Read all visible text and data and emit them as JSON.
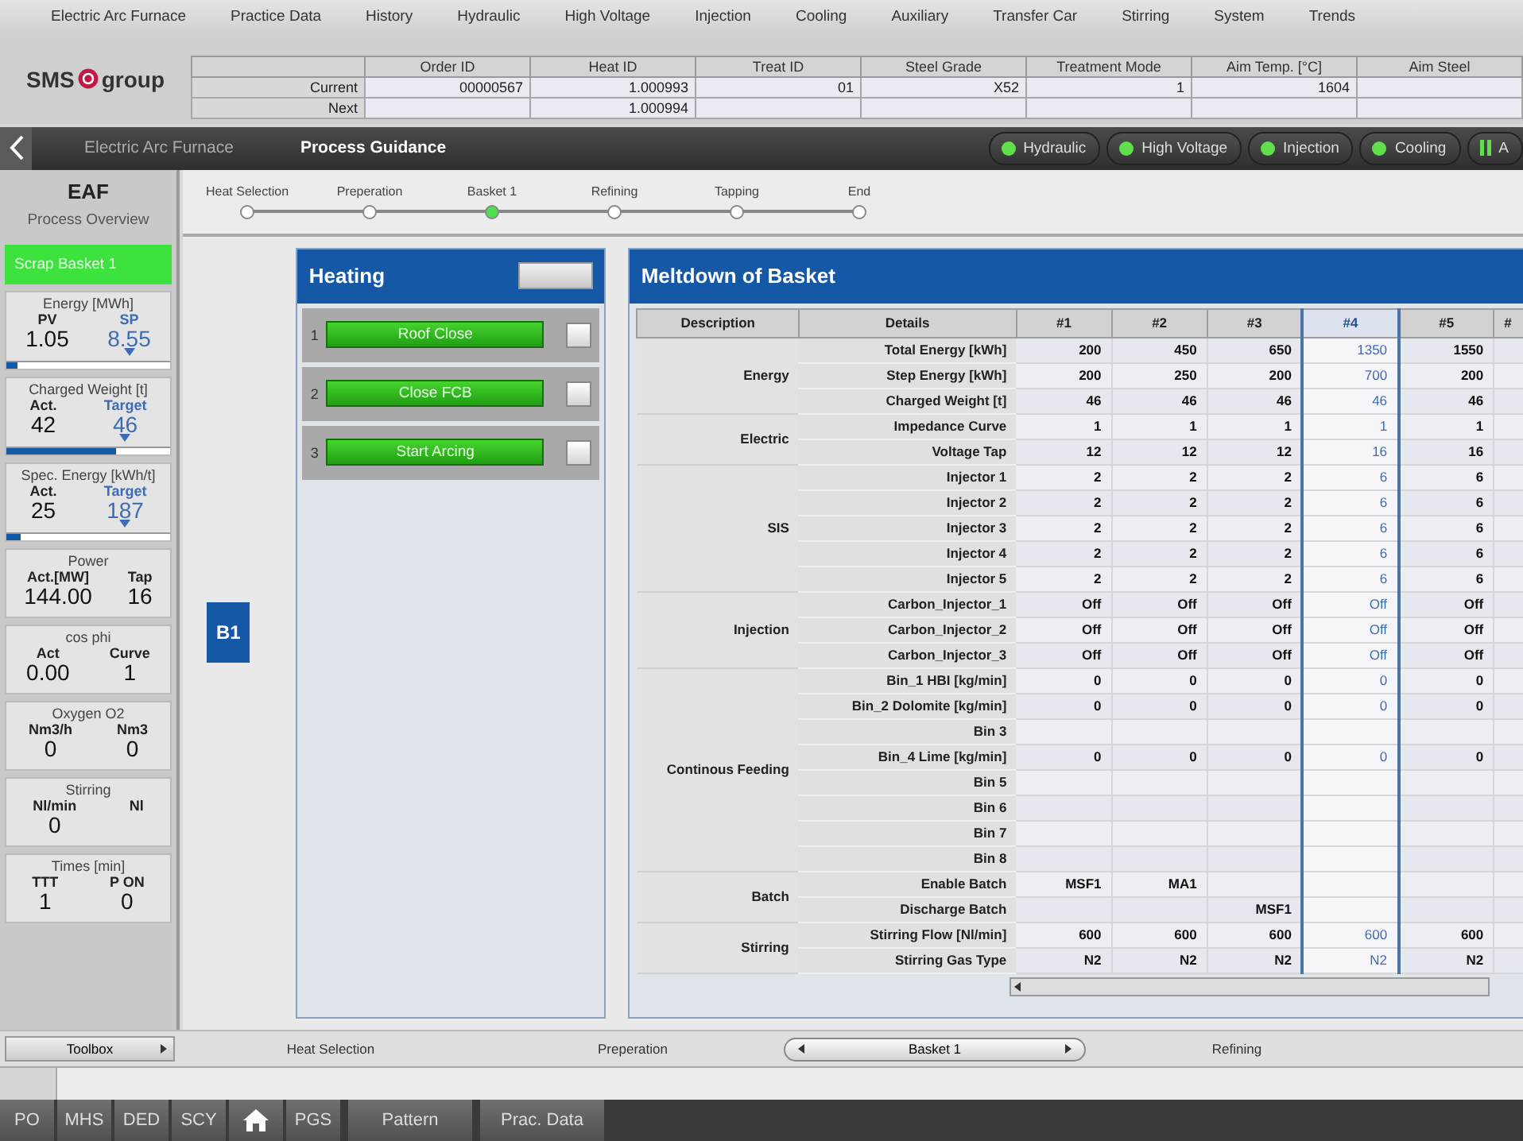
{
  "menu": [
    "Electric Arc Furnace",
    "Practice Data",
    "History",
    "Hydraulic",
    "High Voltage",
    "Injection",
    "Cooling",
    "Auxiliary",
    "Transfer Car",
    "Stirring",
    "System",
    "Trends"
  ],
  "logo": {
    "left": "SMS",
    "right": "group"
  },
  "heat_table": {
    "columns": [
      null,
      "Order ID",
      "Heat ID",
      "Treat ID",
      "Steel Grade",
      "Treatment Mode",
      "Aim Temp. [°C]",
      "Aim Steel"
    ],
    "rows": [
      [
        "Current",
        "00000567",
        "1.000993",
        "01",
        "X52",
        "1",
        "1604"
      ],
      [
        "Next",
        null,
        "1.000994"
      ]
    ]
  },
  "nav": {
    "breadcrumbs": [
      {
        "label": "Electric Arc Furnace",
        "selected": false
      },
      {
        "label": "Process Guidance",
        "selected": true
      }
    ],
    "status": [
      {
        "label": "Hydraulic",
        "kind": "ok"
      },
      {
        "label": "High Voltage",
        "kind": "ok"
      },
      {
        "label": "Injection",
        "kind": "ok"
      },
      {
        "label": "Cooling",
        "kind": "ok"
      },
      {
        "label": "A",
        "kind": "paused"
      }
    ]
  },
  "sidebar": {
    "title": "EAF",
    "subtitle": "Process Overview",
    "banner": "Scrap Basket 1",
    "cards": [
      {
        "title": "Energy [MWh]",
        "left": {
          "label": "PV",
          "value": "1.05"
        },
        "right": {
          "label": "SP",
          "value": "8.55",
          "target": true
        },
        "level": 0.07
      },
      {
        "title": "Charged Weight [t]",
        "left": {
          "label": "Act.",
          "value": "42"
        },
        "right": {
          "label": "Target",
          "value": "46",
          "target": true
        },
        "level": 0.67
      },
      {
        "title": "Spec. Energy [kWh/t]",
        "left": {
          "label": "Act.",
          "value": "25"
        },
        "right": {
          "label": "Target",
          "value": "187",
          "target": true
        },
        "level": 0.09
      },
      {
        "title": "Power",
        "left": {
          "label": "Act.[MW]",
          "value": "144.00"
        },
        "right": {
          "label": "Tap",
          "value": "16",
          "target": false
        }
      },
      {
        "title": "cos phi",
        "left": {
          "label": "Act",
          "value": "0.00"
        },
        "right": {
          "label": "Curve",
          "value": "1",
          "target": false
        }
      },
      {
        "title": "Oxygen O2",
        "left": {
          "label": "Nm3/h",
          "value": "0"
        },
        "right": {
          "label": "Nm3",
          "value": "0",
          "target": false
        }
      },
      {
        "title": "Stirring",
        "left": {
          "label": "Nl/min",
          "value": "0"
        },
        "right": {
          "label": "Nl",
          "target": false
        }
      },
      {
        "title": "Times [min]",
        "left": {
          "label": "TTT",
          "value": "1"
        },
        "right": {
          "label": "P ON",
          "value": "0",
          "target": false
        }
      }
    ]
  },
  "progress": [
    {
      "label": "Heat Selection",
      "selected": false
    },
    {
      "label": "Preperation",
      "selected": false
    },
    {
      "label": "Basket 1",
      "selected": true
    },
    {
      "label": "Refining",
      "selected": false
    },
    {
      "label": "Tapping",
      "selected": false
    },
    {
      "label": "End",
      "selected": false
    }
  ],
  "basket_button": "B1",
  "heating": {
    "title": "Heating",
    "steps": [
      {
        "number": "1",
        "label": "Roof Close"
      },
      {
        "number": "2",
        "label": "Close FCB"
      },
      {
        "number": "3",
        "label": "Start Arcing"
      }
    ]
  },
  "meltdown": {
    "title": "Meltdown of Basket",
    "description_header": "Description",
    "details_header": "Details",
    "columns": [
      {
        "label": "#1",
        "selected": false
      },
      {
        "label": "#2",
        "selected": false
      },
      {
        "label": "#3",
        "selected": false
      },
      {
        "label": "#4",
        "selected": true
      },
      {
        "label": "#5",
        "selected": false
      },
      {
        "label": "#",
        "selected": false
      }
    ],
    "groups": [
      {
        "name": "Energy",
        "rows": [
          {
            "detail": "Total Energy [kWh]",
            "values": [
              "200",
              "450",
              "650",
              "1350",
              "1550"
            ]
          },
          {
            "detail": "Step Energy [kWh]",
            "values": [
              "200",
              "250",
              "200",
              "700",
              "200"
            ]
          },
          {
            "detail": "Charged Weight [t]",
            "values": [
              "46",
              "46",
              "46",
              "46",
              "46"
            ]
          }
        ]
      },
      {
        "name": "Electric",
        "rows": [
          {
            "detail": "Impedance Curve",
            "values": [
              "1",
              "1",
              "1",
              "1",
              "1"
            ]
          },
          {
            "detail": "Voltage Tap",
            "values": [
              "12",
              "12",
              "12",
              "16",
              "16"
            ]
          }
        ]
      },
      {
        "name": "SIS",
        "rows": [
          {
            "detail": "Injector 1",
            "values": [
              "2",
              "2",
              "2",
              "6",
              "6"
            ]
          },
          {
            "detail": "Injector 2",
            "values": [
              "2",
              "2",
              "2",
              "6",
              "6"
            ]
          },
          {
            "detail": "Injector 3",
            "values": [
              "2",
              "2",
              "2",
              "6",
              "6"
            ]
          },
          {
            "detail": "Injector 4",
            "values": [
              "2",
              "2",
              "2",
              "6",
              "6"
            ]
          },
          {
            "detail": "Injector 5",
            "values": [
              "2",
              "2",
              "2",
              "6",
              "6"
            ]
          }
        ]
      },
      {
        "name": "Injection",
        "rows": [
          {
            "detail": "Carbon_Injector_1",
            "values": [
              "Off",
              "Off",
              "Off",
              "Off",
              "Off"
            ]
          },
          {
            "detail": "Carbon_Injector_2",
            "values": [
              "Off",
              "Off",
              "Off",
              "Off",
              "Off"
            ]
          },
          {
            "detail": "Carbon_Injector_3",
            "values": [
              "Off",
              "Off",
              "Off",
              "Off",
              "Off"
            ]
          }
        ]
      },
      {
        "name": "Continous Feeding",
        "rows": [
          {
            "detail": "Bin_1 HBI [kg/min]",
            "values": [
              "0",
              "0",
              "0",
              "0",
              "0"
            ]
          },
          {
            "detail": "Bin_2 Dolomite [kg/min]",
            "values": [
              "0",
              "0",
              "0",
              "0",
              "0"
            ]
          },
          {
            "detail": "Bin 3",
            "values": []
          },
          {
            "detail": "Bin_4 Lime [kg/min]",
            "values": [
              "0",
              "0",
              "0",
              "0",
              "0"
            ]
          },
          {
            "detail": "Bin 5",
            "values": []
          },
          {
            "detail": "Bin 6",
            "values": []
          },
          {
            "detail": "Bin 7",
            "values": []
          },
          {
            "detail": "Bin 8",
            "values": []
          }
        ]
      },
      {
        "name": "Batch",
        "rows": [
          {
            "detail": "Enable Batch",
            "values": [
              "MSF1",
              "MA1"
            ]
          },
          {
            "detail": "Discharge Batch",
            "values": {
              "2": "MSF1"
            }
          }
        ]
      },
      {
        "name": "Stirring",
        "rows": [
          {
            "detail": "Stirring Flow [Nl/min]",
            "values": [
              "600",
              "600",
              "600",
              "600",
              "600"
            ]
          },
          {
            "detail": "Stirring Gas Type",
            "values": [
              "N2",
              "N2",
              "N2",
              "N2",
              "N2"
            ]
          }
        ]
      }
    ]
  },
  "toolbox": "Toolbox",
  "step_bar": [
    {
      "label": "Heat Selection",
      "selected": false
    },
    {
      "label": "Preperation",
      "selected": false
    },
    {
      "label": "Basket 1",
      "selected": true
    },
    {
      "label": "Refining",
      "selected": false
    }
  ],
  "bottom_tabs": [
    {
      "kind": "short",
      "label": "PO"
    },
    {
      "kind": "short",
      "label": "MHS"
    },
    {
      "kind": "short",
      "label": "DED"
    },
    {
      "kind": "short",
      "label": "SCY"
    },
    {
      "kind": "home"
    },
    {
      "kind": "short",
      "label": "PGS"
    },
    {
      "kind": "wide",
      "label": "Pattern"
    },
    {
      "kind": "wide",
      "label": "Prac. Data"
    }
  ]
}
